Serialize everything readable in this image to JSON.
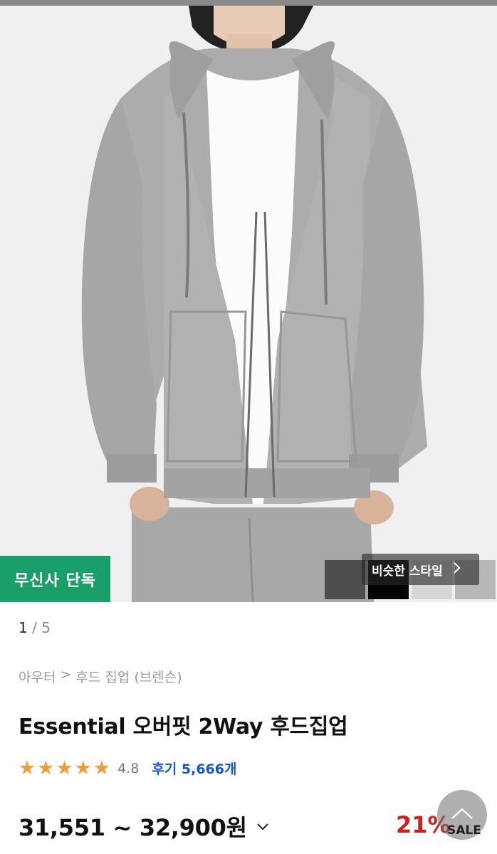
{
  "product": {
    "exclusive_badge": "무신사 단독",
    "similar_style_label": "비슷한 스타일",
    "pager": {
      "current": "1",
      "separator": "/",
      "total": "5"
    },
    "breadcrumb": [
      "아우터",
      ">",
      "후드 집업 (브렌슨)"
    ],
    "title": "Essential 오버핏 2Way 후드집업",
    "rating": "4.8",
    "reviews_label": "후기 5,666개",
    "price_range": "31,551 ~ 32,900원",
    "discount": "21%",
    "sale_label": "SALE"
  },
  "thumbnails": [
    {
      "name": "thumb-charcoal",
      "color": "#4d4d4d"
    },
    {
      "name": "thumb-black",
      "color": "#050505"
    },
    {
      "name": "thumb-light-gray",
      "color": "#d6d6d6"
    },
    {
      "name": "thumb-gray",
      "color": "#b8b8b8"
    }
  ],
  "icons": {
    "star": "star-icon",
    "chevron_down": "chevron-down-icon",
    "chevron_right": "chevron-right-icon",
    "scroll_top": "chevron-up-icon"
  },
  "colors": {
    "accent_green": "#1a9e6a",
    "star_orange": "#f29b3a",
    "review_blue": "#1a56c9",
    "discount_red": "#d0201c"
  }
}
